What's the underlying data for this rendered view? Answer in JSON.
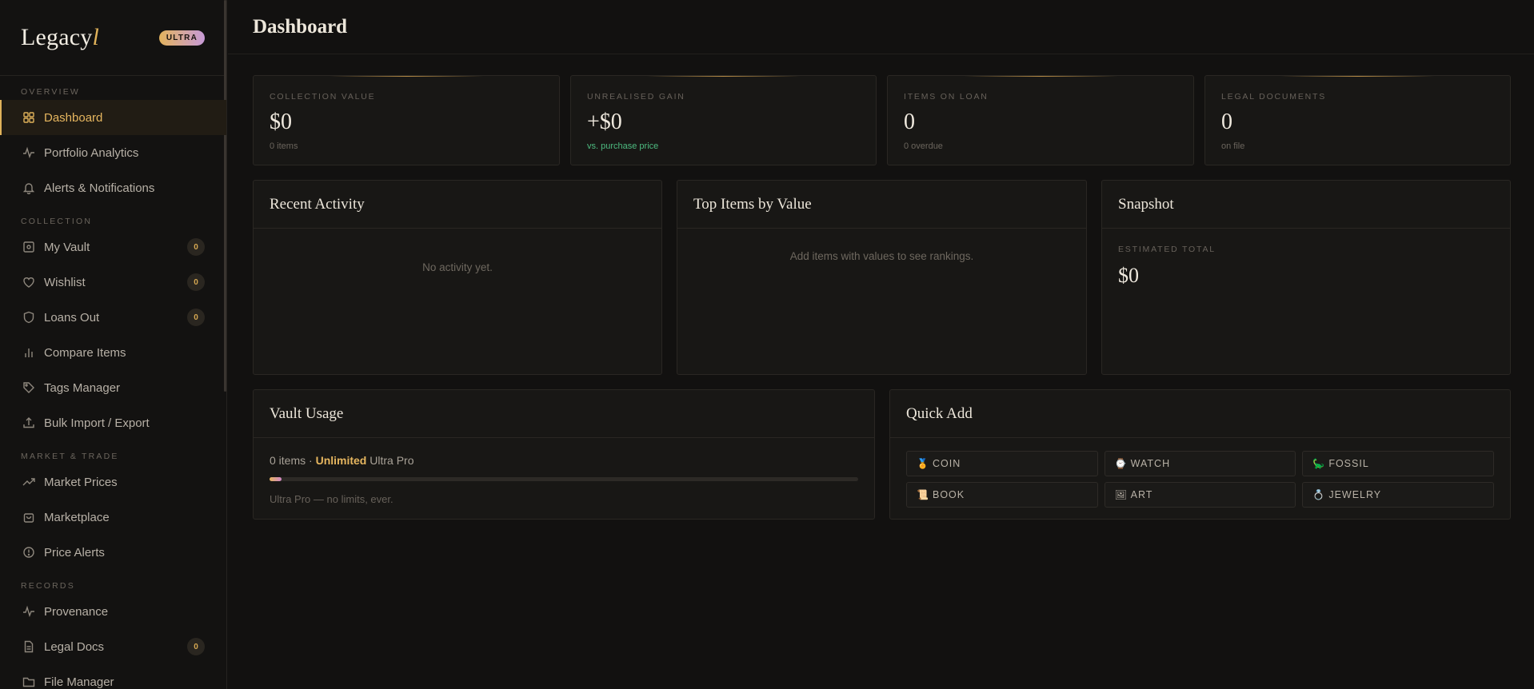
{
  "brand": {
    "name": "Legacy",
    "accent": "l",
    "tier": "ULTRA"
  },
  "sidebar": {
    "sections": [
      {
        "label": "OVERVIEW",
        "items": [
          {
            "label": "Dashboard",
            "icon": "grid-icon",
            "active": true
          },
          {
            "label": "Portfolio Analytics",
            "icon": "activity-icon"
          },
          {
            "label": "Alerts & Notifications",
            "icon": "bell-icon"
          }
        ]
      },
      {
        "label": "COLLECTION",
        "items": [
          {
            "label": "My Vault",
            "icon": "vault-icon",
            "badge": "0"
          },
          {
            "label": "Wishlist",
            "icon": "heart-icon",
            "badge": "0"
          },
          {
            "label": "Loans Out",
            "icon": "shield-icon",
            "badge": "0"
          },
          {
            "label": "Compare Items",
            "icon": "bar-chart-icon"
          },
          {
            "label": "Tags Manager",
            "icon": "tag-icon"
          },
          {
            "label": "Bulk Import / Export",
            "icon": "upload-icon"
          }
        ]
      },
      {
        "label": "MARKET & TRADE",
        "items": [
          {
            "label": "Market Prices",
            "icon": "trending-up-icon"
          },
          {
            "label": "Marketplace",
            "icon": "shopping-bag-icon"
          },
          {
            "label": "Price Alerts",
            "icon": "alert-circle-icon"
          }
        ]
      },
      {
        "label": "RECORDS",
        "items": [
          {
            "label": "Provenance",
            "icon": "activity-icon"
          },
          {
            "label": "Legal Docs",
            "icon": "document-icon",
            "badge": "0"
          },
          {
            "label": "File Manager",
            "icon": "folder-icon"
          }
        ]
      }
    ]
  },
  "header": {
    "title": "Dashboard"
  },
  "stats": [
    {
      "label": "COLLECTION VALUE",
      "value": "$0",
      "sub": "0 items"
    },
    {
      "label": "UNREALISED GAIN",
      "value": "+$0",
      "sub": "vs. purchase price"
    },
    {
      "label": "ITEMS ON LOAN",
      "value": "0",
      "sub": "0 overdue"
    },
    {
      "label": "LEGAL DOCUMENTS",
      "value": "0",
      "sub": "on file"
    }
  ],
  "recent_activity": {
    "title": "Recent Activity",
    "empty": "No activity yet."
  },
  "top_items": {
    "title": "Top Items by Value",
    "empty": "Add items with values to see rankings."
  },
  "snapshot": {
    "title": "Snapshot",
    "label": "ESTIMATED TOTAL",
    "value": "$0"
  },
  "vault_usage": {
    "title": "Vault Usage",
    "count": "0 items",
    "separator": "·",
    "limit": "Unlimited",
    "plan": "Ultra Pro",
    "progress": 0.02,
    "note": "Ultra Pro — no limits, ever."
  },
  "quick_add": {
    "title": "Quick Add",
    "items": [
      {
        "label": "COIN",
        "icon": "🏅"
      },
      {
        "label": "WATCH",
        "icon": "⌚"
      },
      {
        "label": "FOSSIL",
        "icon": "🦕"
      },
      {
        "label": "BOOK",
        "icon": "📜"
      },
      {
        "label": "ART",
        "icon": "🖼"
      },
      {
        "label": "JEWELRY",
        "icon": "💍"
      }
    ]
  },
  "colors": {
    "accent": "#e0b25a",
    "gain": "#4dbb80",
    "background": "#121110",
    "card": "#181715"
  }
}
